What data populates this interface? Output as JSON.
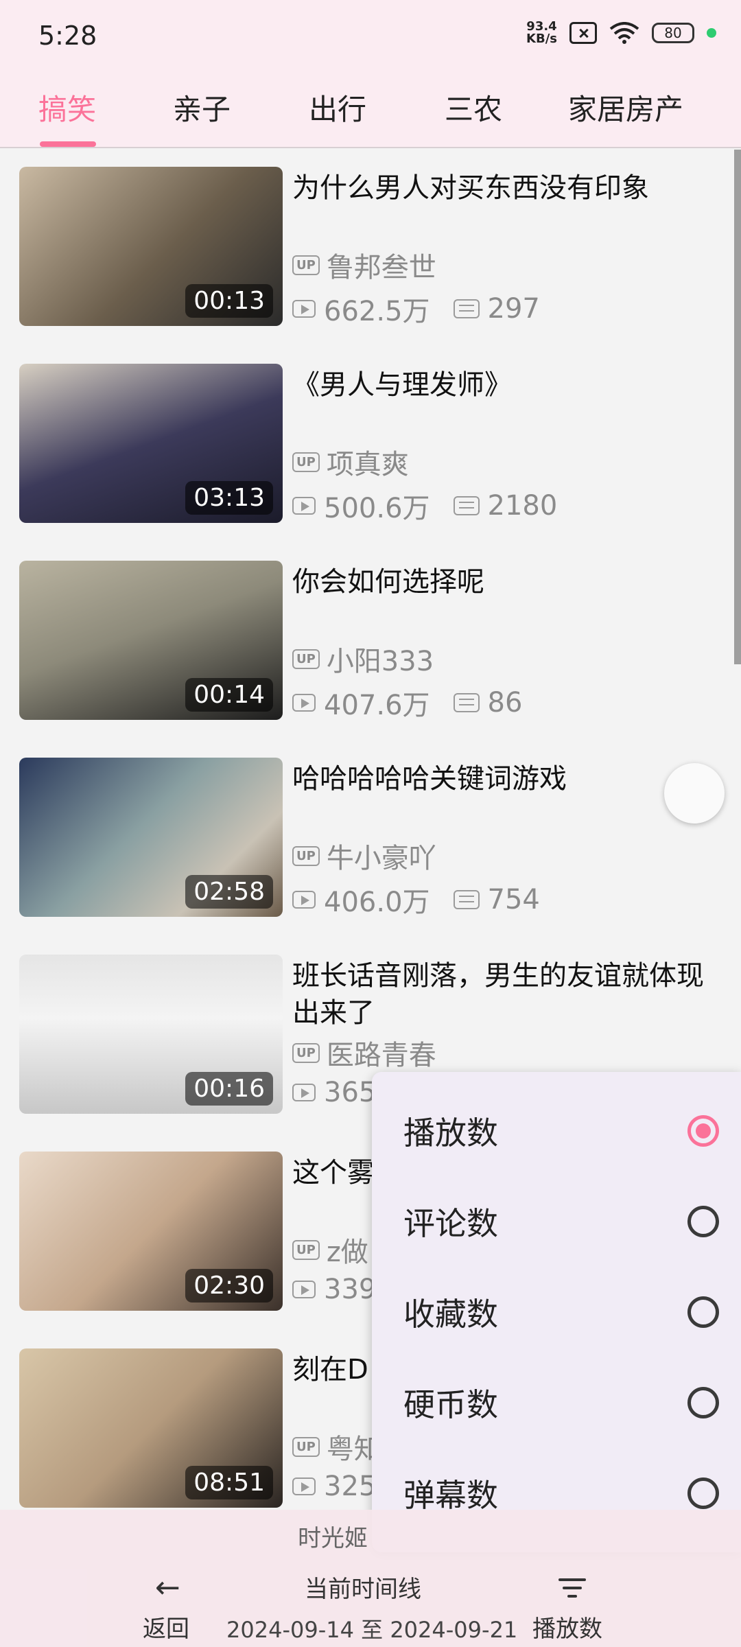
{
  "status_bar": {
    "time": "5:28",
    "net_speed_top": "93.4",
    "net_speed_unit": "KB/s",
    "battery": "80"
  },
  "tabs": [
    {
      "label": "搞笑",
      "active": true
    },
    {
      "label": "亲子"
    },
    {
      "label": "出行"
    },
    {
      "label": "三农"
    },
    {
      "label": "家居房产"
    }
  ],
  "videos": [
    {
      "title": "为什么男人对买东西没有印象",
      "up": "鲁邦叁世",
      "views": "662.5万",
      "comments": "297",
      "duration": "00:13"
    },
    {
      "title": "《男人与理发师》",
      "up": "项真爽",
      "views": "500.6万",
      "comments": "2180",
      "duration": "03:13"
    },
    {
      "title": "你会如何选择呢",
      "up": "小阳333",
      "views": "407.6万",
      "comments": "86",
      "duration": "00:14"
    },
    {
      "title": "哈哈哈哈哈关键词游戏",
      "up": "牛小豪吖",
      "views": "406.0万",
      "comments": "754",
      "duration": "02:58"
    },
    {
      "title": "班长话音刚落，男生的友谊就体现出来了",
      "up": "医路青春",
      "views": "365",
      "comments": "",
      "duration": "00:16"
    },
    {
      "title": "这个雾啊哈哈",
      "up": "z做",
      "views": "339",
      "comments": "",
      "duration": "02:30"
    },
    {
      "title": "刻在D",
      "up": "粤知",
      "views": "325",
      "comments": "",
      "duration": "08:51"
    }
  ],
  "sort_menu": {
    "options": [
      {
        "label": "播放数",
        "selected": true
      },
      {
        "label": "评论数",
        "selected": false
      },
      {
        "label": "收藏数",
        "selected": false
      },
      {
        "label": "硬币数",
        "selected": false
      },
      {
        "label": "弹幕数",
        "selected": false
      }
    ]
  },
  "bottom_bar": {
    "back_label": "返回",
    "name_text": "时光姬",
    "timeline_label": "当前时间线",
    "date_range": "2024-09-14 至 2024-09-21",
    "sort_label": "播放数"
  },
  "colors": {
    "accent": "#fb7299",
    "header_bg": "#fbecf2",
    "menu_bg": "#f1ecf6"
  }
}
